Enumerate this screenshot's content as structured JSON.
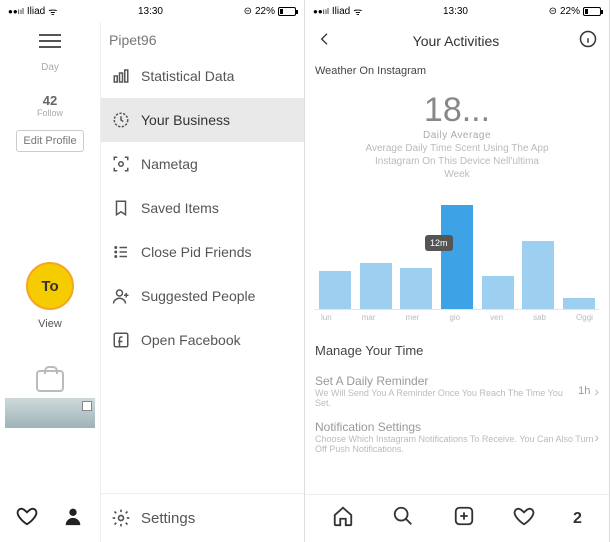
{
  "status": {
    "carrier": "Iliad",
    "wifi": "ᯤ",
    "time": "13:30",
    "battery_pct": "22%"
  },
  "left": {
    "username": "Pipet96",
    "day_label": "Day",
    "count": "42",
    "follow_label": "Follow",
    "edit_profile": "Edit Profile",
    "avatar_text": "To",
    "view_label": "View",
    "menu": {
      "statistical_data": "Statistical Data",
      "your_business": "Your Business",
      "nametag": "Nametag",
      "saved_items": "Saved Items",
      "close_friends": "Close Pid Friends",
      "suggested_people": "Suggested People",
      "open_facebook": "Open Facebook"
    },
    "settings": "Settings"
  },
  "right": {
    "header_title": "Your Activities",
    "weather_label": "Weather On Instagram",
    "big_number": "18...",
    "daily_average_label": "Daily Average",
    "avg_desc_1": "Average Daily Time Scent Using The App",
    "avg_desc_2": "Instagram On This Device Nell'ultima",
    "avg_desc_3": "Week",
    "tooltip": "12m",
    "manage_title": "Manage Your Time",
    "reminder_title": "Set A Daily Reminder",
    "reminder_desc": "We Will Send You A Reminder Once You Reach The Time You Set.",
    "reminder_value": "1h",
    "notif_title": "Notification Settings",
    "notif_desc": "Choose Which Instagram Notifications To Receive. You Can Also Turn Off Push Notifications.",
    "badge": "2"
  },
  "chart_data": {
    "type": "bar",
    "categories": [
      "lun",
      "mar",
      "mer",
      "gio",
      "ven",
      "sab",
      "Oggi"
    ],
    "values": [
      35,
      42,
      38,
      95,
      30,
      62,
      10
    ],
    "tooltip_index": 2,
    "tooltip_value": "12m",
    "title": "Daily Average",
    "xlabel": "",
    "ylabel": "",
    "ylim": [
      0,
      100
    ]
  }
}
